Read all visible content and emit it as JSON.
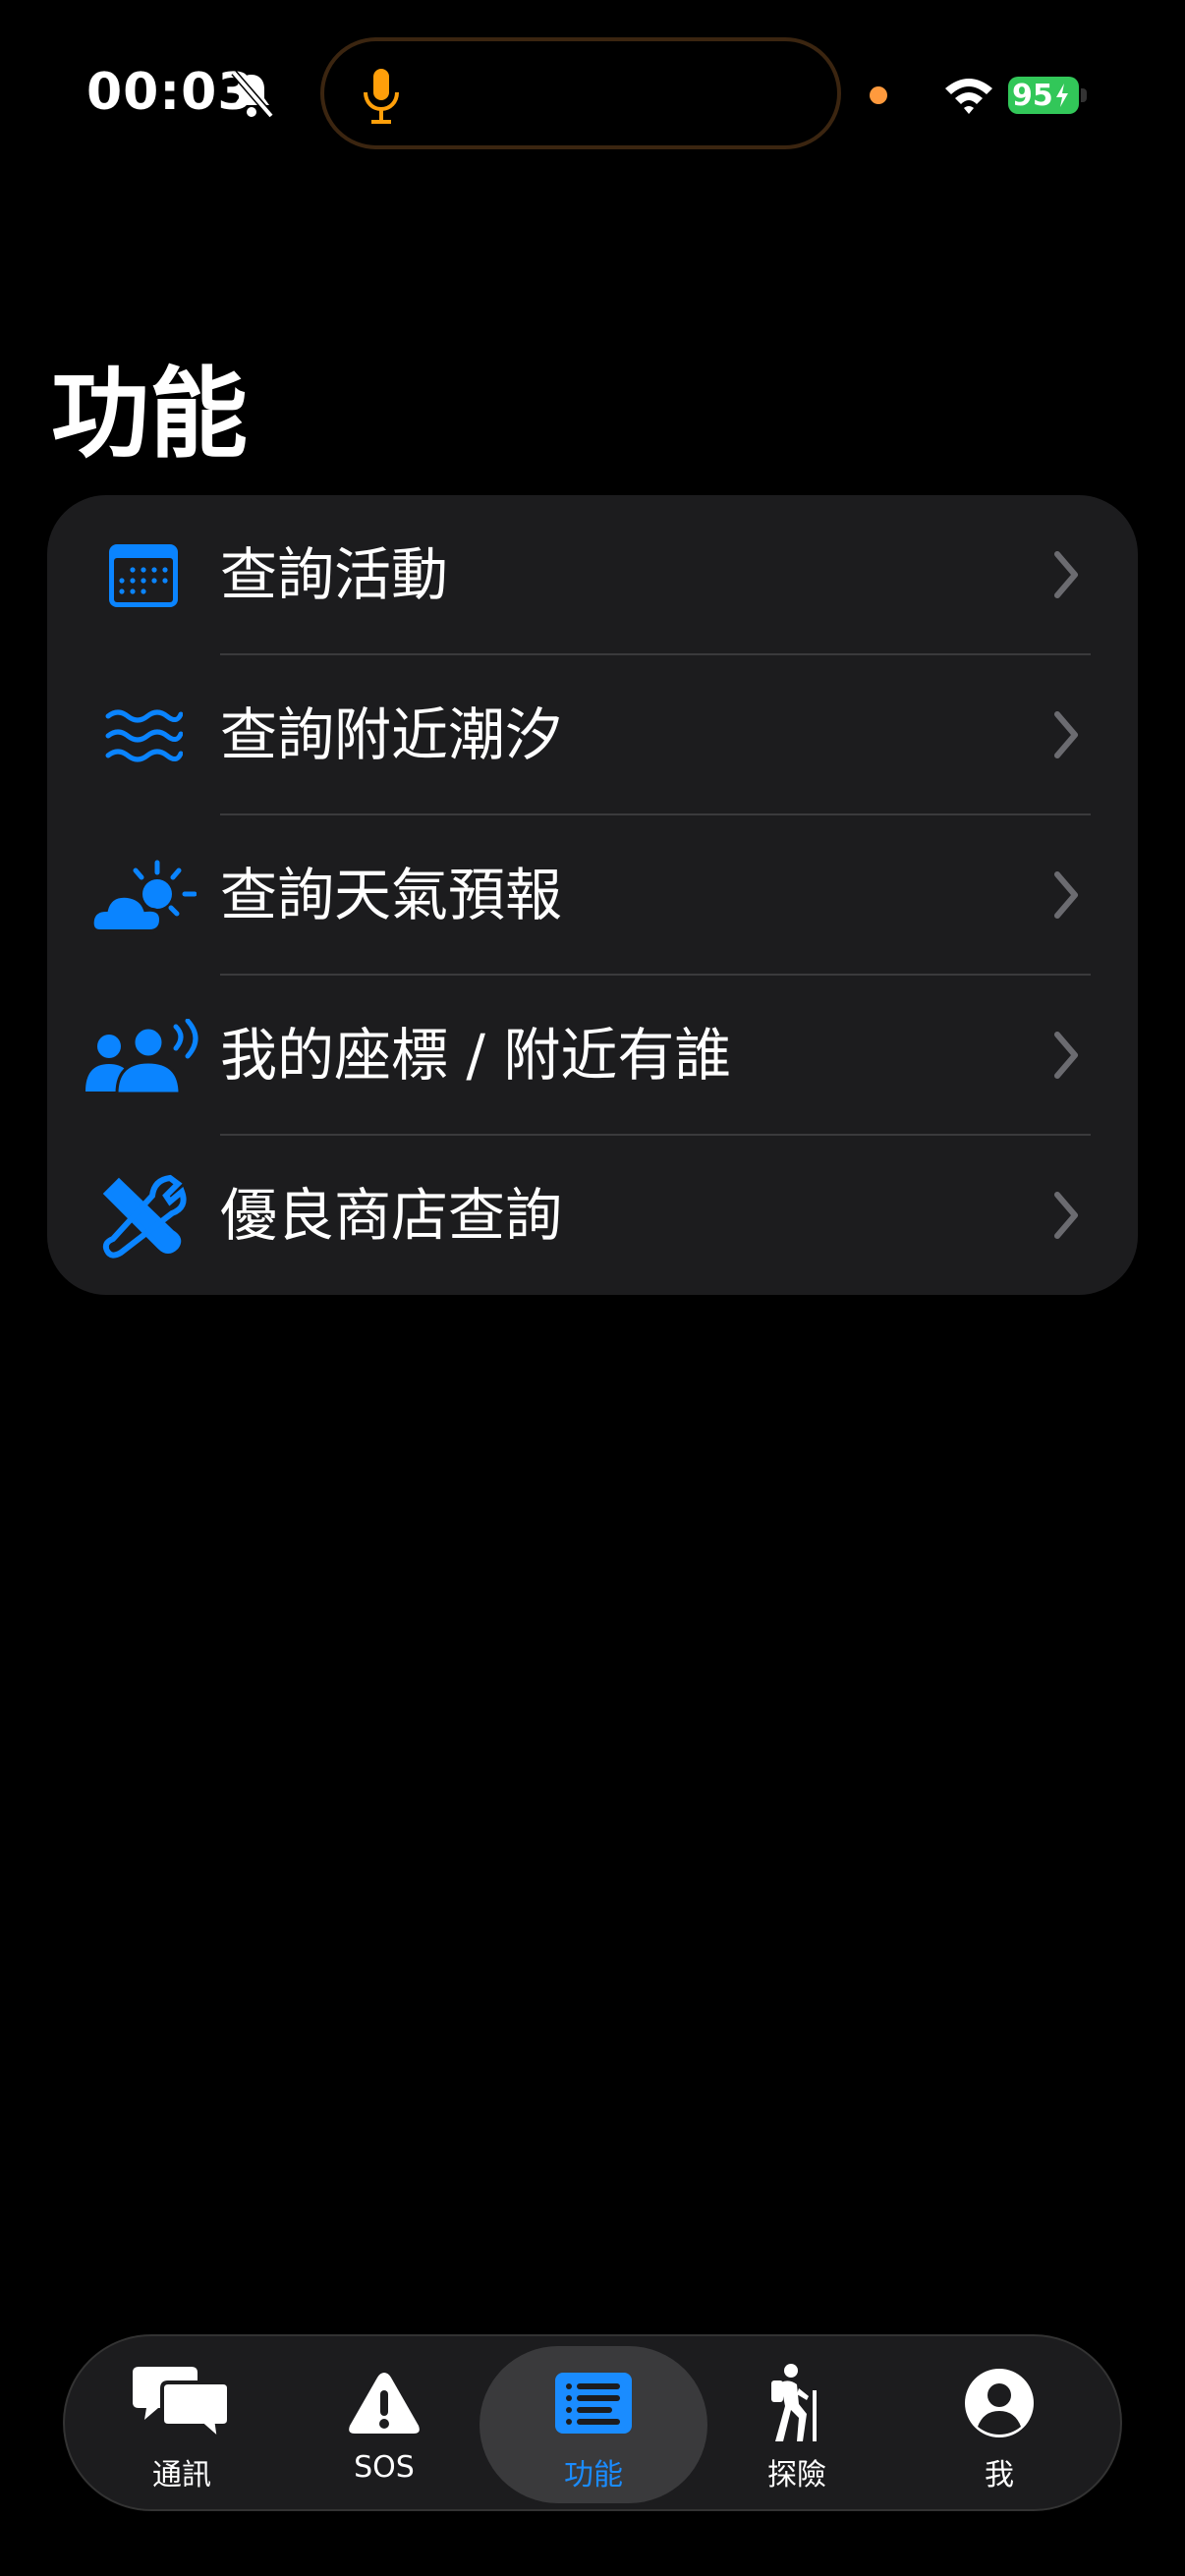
{
  "status": {
    "time": "00:03",
    "battery": "95"
  },
  "page": {
    "title": "功能"
  },
  "list": {
    "items": [
      {
        "label": "查詢活動",
        "icon": "calendar-icon"
      },
      {
        "label": "查詢附近潮汐",
        "icon": "waves-icon"
      },
      {
        "label": "查詢天氣預報",
        "icon": "cloud-sun-icon"
      },
      {
        "label": "我的座標 / 附近有誰",
        "icon": "people-broadcast-icon"
      },
      {
        "label": "優良商店查詢",
        "icon": "tools-icon"
      }
    ]
  },
  "tabs": [
    {
      "label": "通訊",
      "icon": "chat-bubbles-icon"
    },
    {
      "label": "SOS",
      "icon": "warning-icon"
    },
    {
      "label": "功能",
      "icon": "list-icon",
      "active": true
    },
    {
      "label": "探險",
      "icon": "hiker-icon"
    },
    {
      "label": "我",
      "icon": "person-circle-icon"
    }
  ],
  "colors": {
    "accent": "#1a8cff",
    "battery": "#32c759",
    "mic": "#ff9f0a"
  }
}
